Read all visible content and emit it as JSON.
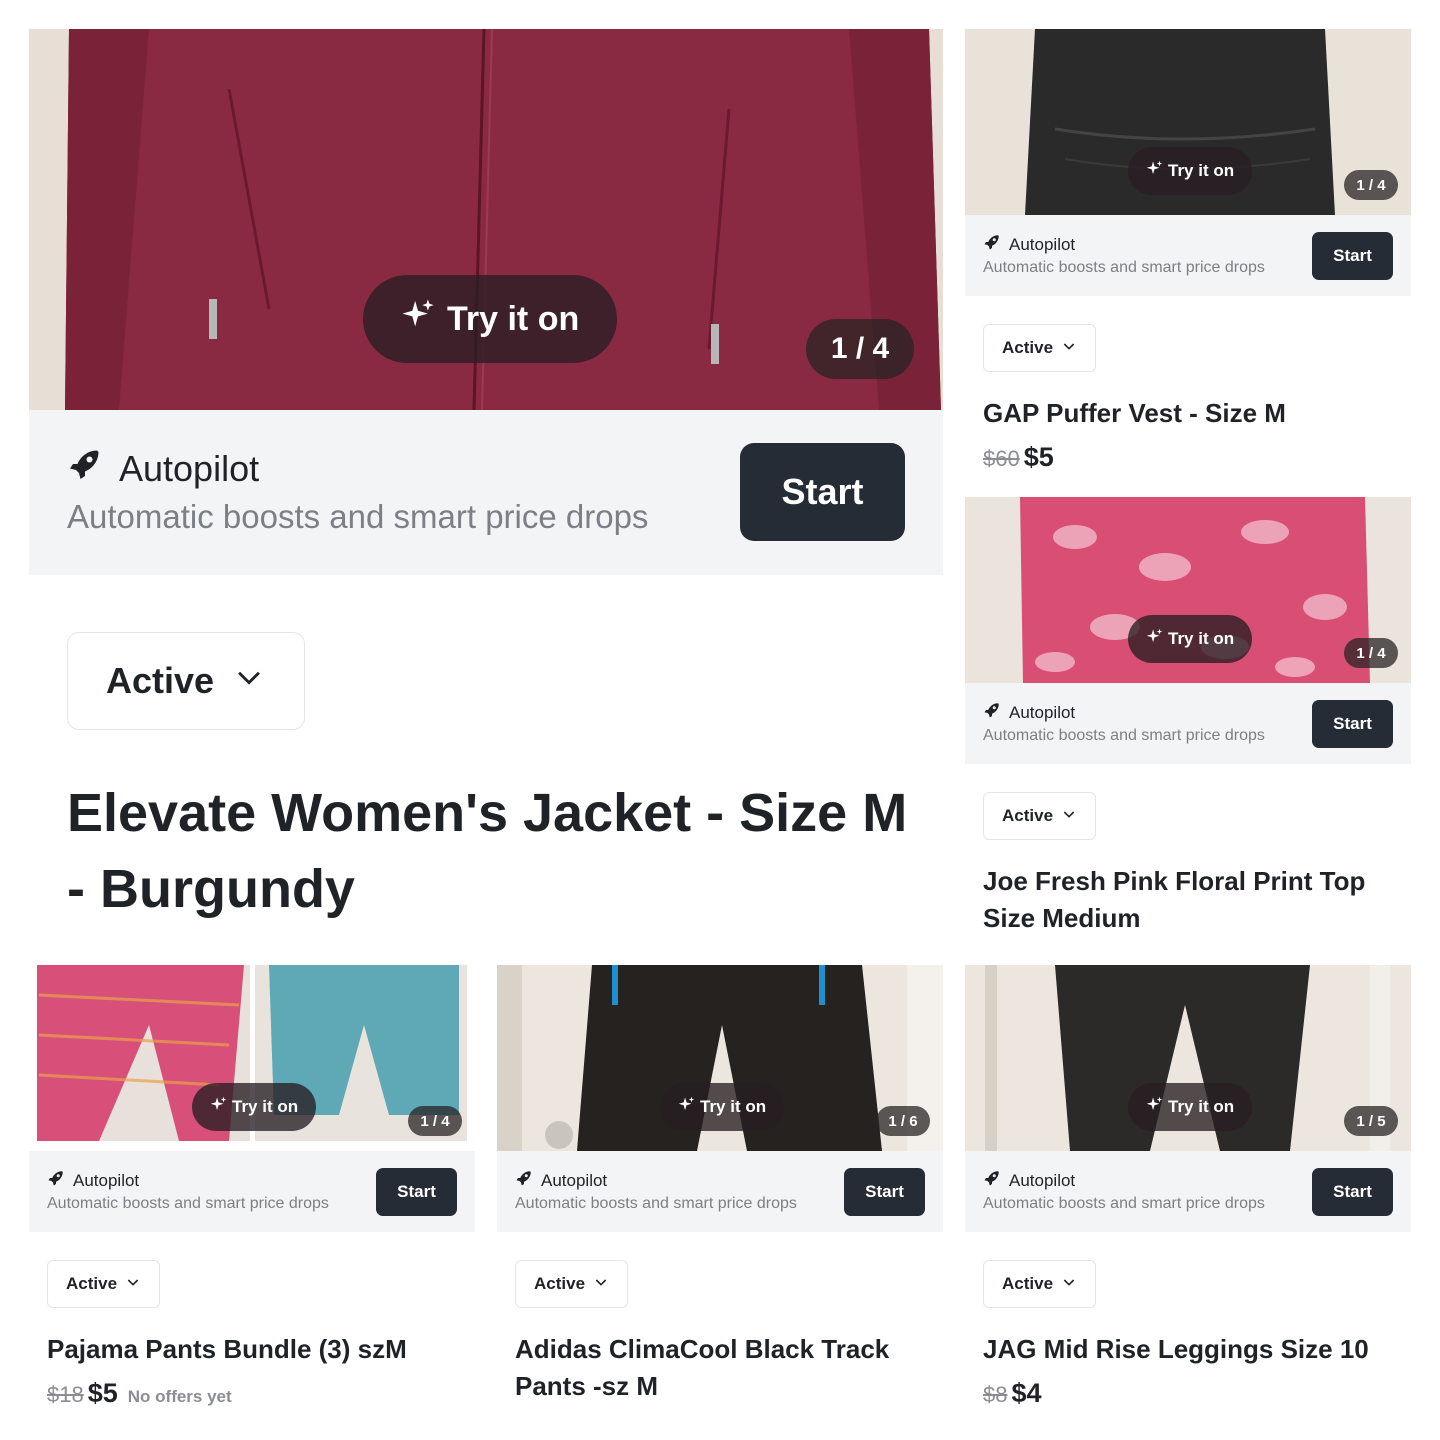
{
  "common": {
    "try_label": "Try it on",
    "autopilot_label": "Autopilot",
    "autopilot_sub": "Automatic boosts and smart price drops",
    "start_label": "Start",
    "status_label": "Active"
  },
  "listings": [
    {
      "id": "jacket",
      "title": "Elevate Women's Jacket - Size M - Burgundy",
      "photo_count": "1 / 4"
    },
    {
      "id": "vest",
      "title": "GAP Puffer Vest - Size M",
      "photo_count": "1 / 4",
      "old_price": "$60",
      "price": "$5"
    },
    {
      "id": "top",
      "title": "Joe Fresh Pink Floral Print Top Size Medium",
      "photo_count": "1 / 4"
    },
    {
      "id": "pajama",
      "title": "Pajama Pants Bundle (3) szM",
      "photo_count": "1 / 4",
      "old_price": "$18",
      "price": "$5",
      "offers": "No offers yet"
    },
    {
      "id": "adidas",
      "title": "Adidas ClimaCool Black Track Pants -sz M",
      "photo_count": "1 / 6"
    },
    {
      "id": "jag",
      "title": "JAG Mid Rise Leggings Size 10",
      "photo_count": "1 / 5",
      "old_price": "$8",
      "price": "$4"
    }
  ],
  "colors": {
    "start_button": "#252c36",
    "autopilot_bar": "#f3f4f6",
    "jacket": "#8a2a42",
    "vest": "#2a2a2a",
    "floral": "#d94e73",
    "pajama_pink": "#d8507a",
    "pajama_teal": "#5fa9b6",
    "track_pants": "#25221f",
    "leggings": "#2c2a28"
  }
}
